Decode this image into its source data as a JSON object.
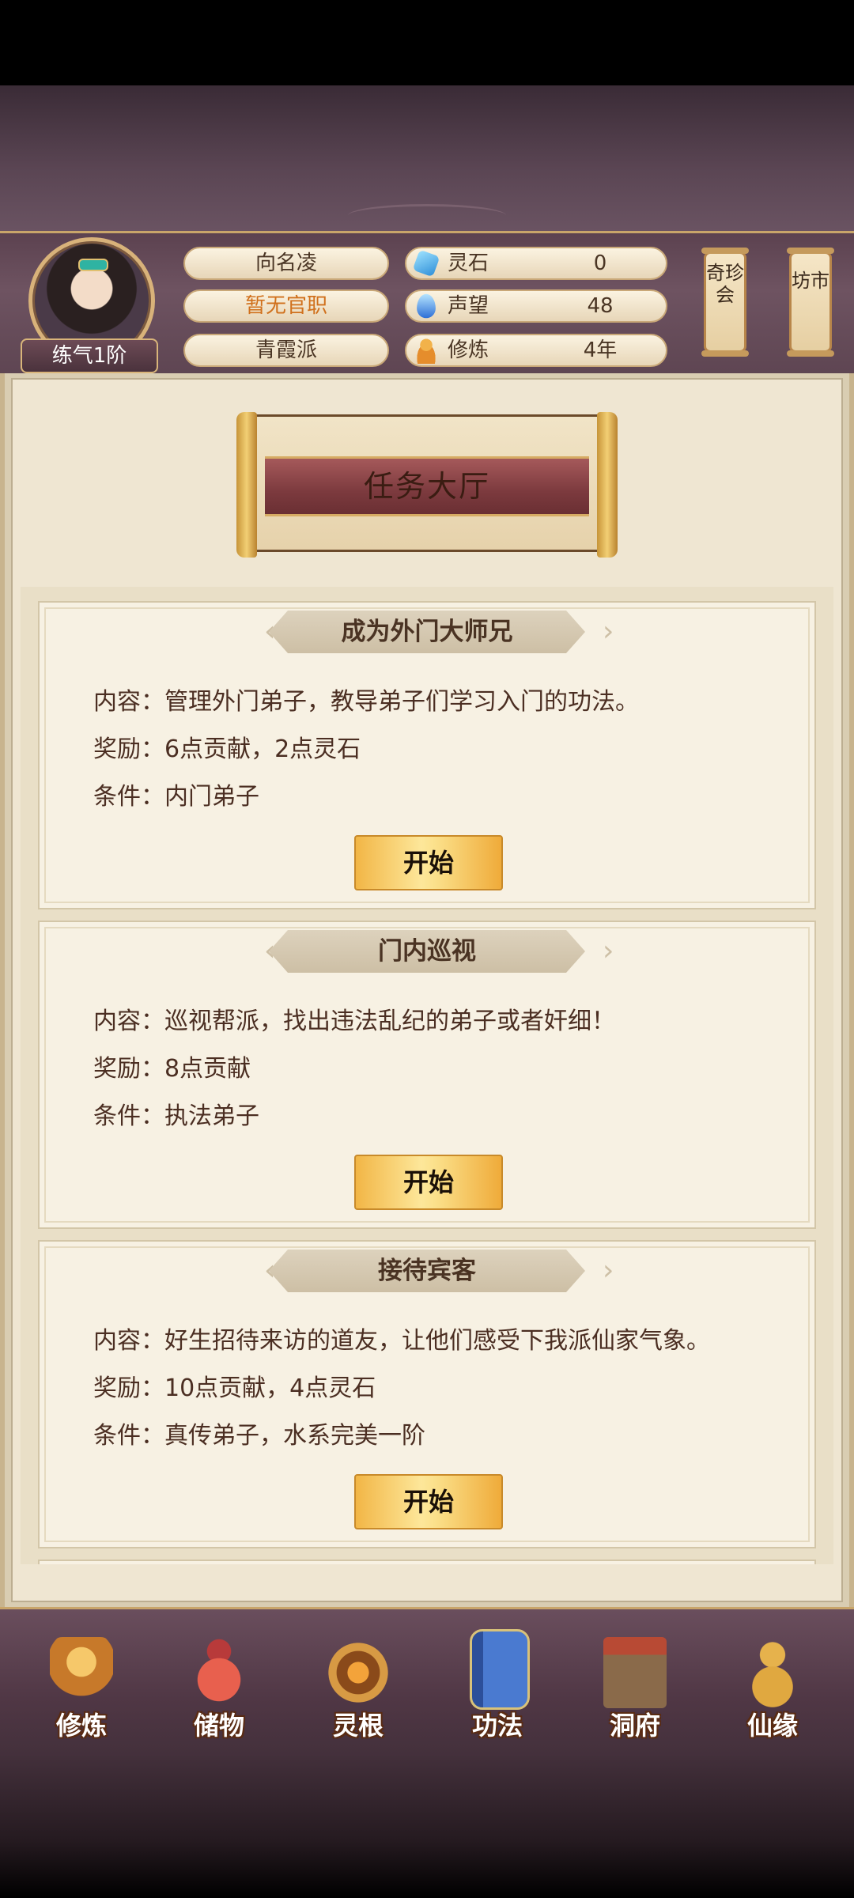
{
  "player": {
    "name": "向名凌",
    "title": "暂无官职",
    "sect": "青霞派",
    "rank": "练气1阶"
  },
  "resources": [
    {
      "icon": "spirit-stone-icon",
      "label": "灵石",
      "value": "0"
    },
    {
      "icon": "prestige-drop-icon",
      "label": "声望",
      "value": "48"
    },
    {
      "icon": "meditation-icon",
      "label": "修炼",
      "value": "4年"
    }
  ],
  "side_buttons": {
    "treasure": "奇珍会",
    "market": "坊市"
  },
  "page_title": "任务大厅",
  "quests": [
    {
      "name": "成为外门大师兄",
      "content": "内容：管理外门弟子，教导弟子们学习入门的功法。",
      "reward": "奖励：6点贡献，2点灵石",
      "condition": "条件：内门弟子",
      "button": "开始"
    },
    {
      "name": "门内巡视",
      "content": "内容：巡视帮派，找出违法乱纪的弟子或者奸细！",
      "reward": "奖励：8点贡献",
      "condition": "条件：执法弟子",
      "button": "开始"
    },
    {
      "name": "接待宾客",
      "content": "内容：好生招待来访的道友，让他们感受下我派仙家气象。",
      "reward": "奖励：10点贡献，4点灵石",
      "condition": "条件：真传弟子，水系完美一阶",
      "button": "开始"
    }
  ],
  "nav": [
    {
      "label": "修炼",
      "icon": "cultivate-icon",
      "color": "#d48a2a"
    },
    {
      "label": "储物",
      "icon": "storage-bag-icon",
      "color": "#d44a4a"
    },
    {
      "label": "灵根",
      "icon": "spirit-root-icon",
      "color": "#c8702a"
    },
    {
      "label": "功法",
      "icon": "technique-book-icon",
      "color": "#3a6ab8"
    },
    {
      "label": "洞府",
      "icon": "cave-residence-icon",
      "color": "#8a6a4a"
    },
    {
      "label": "仙缘",
      "icon": "fate-gourd-icon",
      "color": "#c89a3a"
    }
  ],
  "colors": {
    "accent_gold": "#f2b646",
    "title_orange": "#d0701c",
    "header_purple": "#6e5361"
  }
}
